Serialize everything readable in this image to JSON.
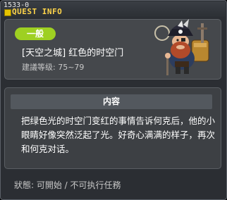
{
  "window": {
    "quest_id": "1533-0",
    "title": "QUEST INFO"
  },
  "quest": {
    "category": "一般",
    "name": "[天空之城] 红色的时空门",
    "recommended_level": "建議等级: 75~79"
  },
  "content": {
    "header": "内容",
    "lines": [
      "把绿色光的时空门变红的事情告诉何克后，他的小",
      "眼睛好像突然泛起了光。好奇心满满的样子，再次",
      "和何克对话。"
    ]
  },
  "status": {
    "text": "狀態: 可開始 / 不可执行任務"
  },
  "icons": {
    "title_icon": "quest-info-icon",
    "npc": "npc-pirate-portrait"
  },
  "colors": {
    "title": "#ffd54a",
    "badge": "#9ed022",
    "panel": "#45484c"
  }
}
